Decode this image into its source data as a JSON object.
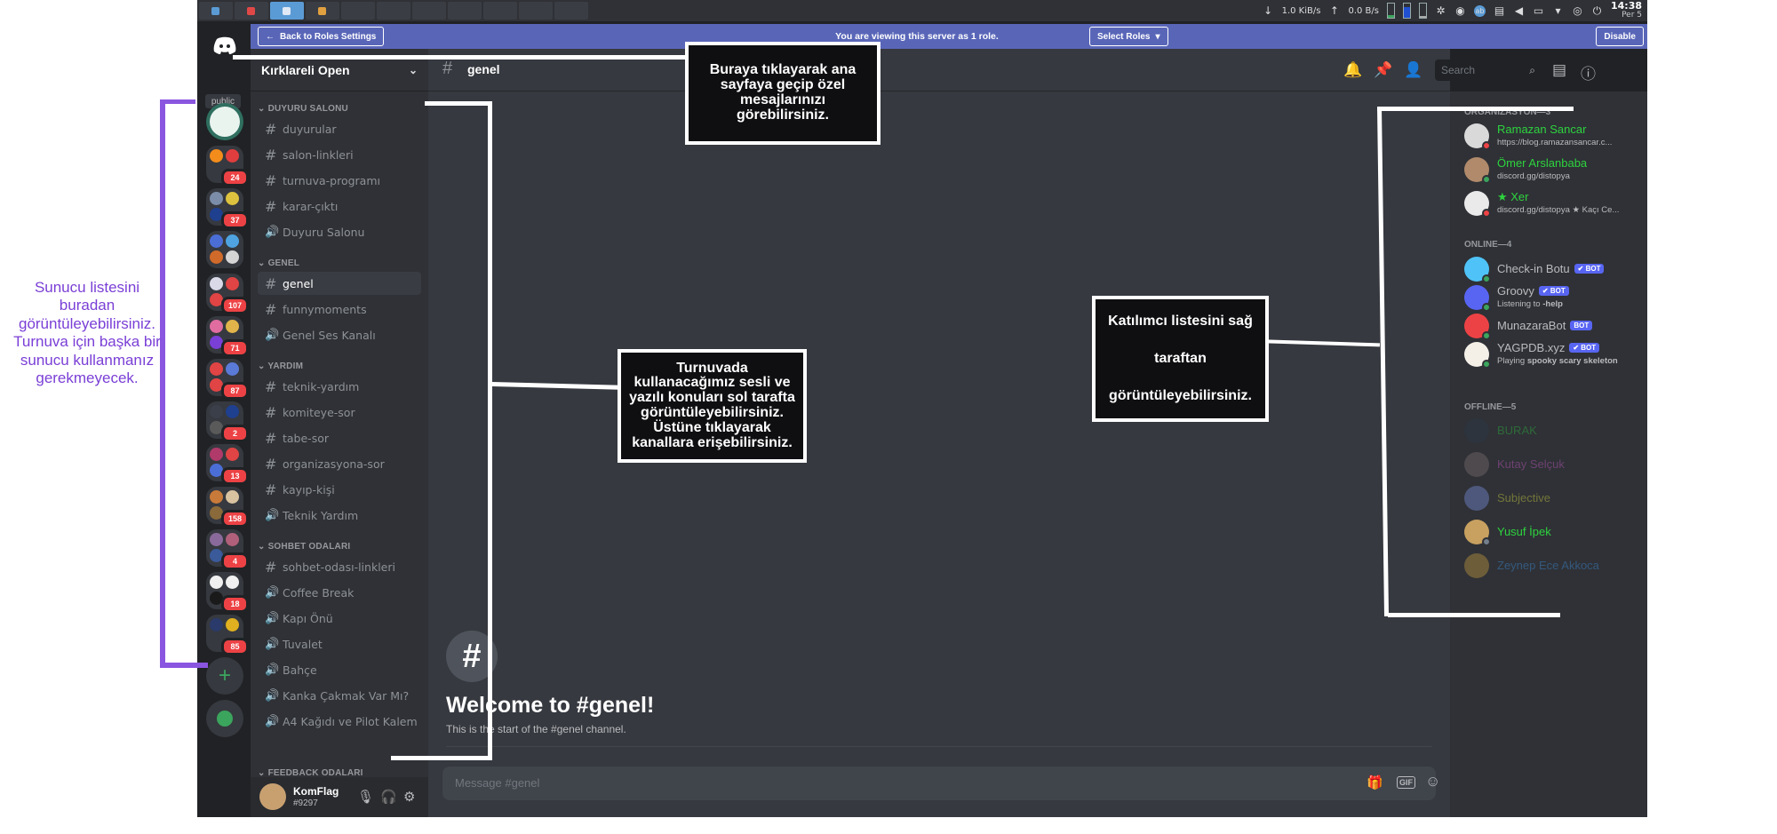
{
  "taskbar": {
    "net_down": "1.0 KiB/s",
    "net_up": "0.0 B/s",
    "clock_time": "14:38",
    "clock_day": "Per 5"
  },
  "notice": {
    "back_label": "Back to Roles Settings",
    "text": "You are viewing this server as 1 role.",
    "select_roles_label": "Select Roles",
    "disable_label": "Disable"
  },
  "rail": {
    "public_label": "public",
    "badges": [
      "24",
      "37",
      "107",
      "71",
      "87",
      "2",
      "13",
      "158",
      "4",
      "18",
      "85"
    ]
  },
  "guild": {
    "name": "Kırklareli Open"
  },
  "categories": {
    "c1": "DUYURU SALONU",
    "c2": "GENEL",
    "c3": "YARDIM",
    "c4": "SOHBET ODALARI",
    "c5": "FEEDBACK ODALARI"
  },
  "channels": [
    "duyurular",
    "salon-linkleri",
    "turnuva-programı",
    "karar-çıktı",
    "Duyuru Salonu",
    "genel",
    "funnymoments",
    "Genel Ses Kanalı",
    "teknik-yardım",
    "komiteye-sor",
    "tabe-sor",
    "organizasyona-sor",
    "kayıp-kişi",
    "Teknik Yardım",
    "sohbet-odası-linkleri",
    "Coffee Break",
    "Kapı Önü",
    "Tuvalet",
    "Bahçe",
    "Kanka Çakmak Var Mı?",
    "A4 Kağıdı ve Pilot Kalem"
  ],
  "user": {
    "name": "KomFlag",
    "tag": "#9297"
  },
  "main": {
    "channel_name": "genel",
    "search_placeholder": "Search",
    "welcome_title": "Welcome to #genel!",
    "welcome_sub": "This is the start of the #genel channel.",
    "composer_placeholder": "Message #genel",
    "gif_label": "GIF"
  },
  "members": {
    "cat_org": "ORGANIZASYON—3",
    "cat_online": "ONLINE—4",
    "cat_offline": "OFFLINE—5",
    "bot_label": "BOT",
    "org": [
      {
        "name": "Ramazan Sancar",
        "sub": "https://blog.ramazansancar.c..."
      },
      {
        "name": "Ömer Arslanbaba",
        "sub": "discord.gg/distopya"
      },
      {
        "name": "★ Xer",
        "sub": "discord.gg/distopya ★ Kaçı Ce..."
      }
    ],
    "online": [
      {
        "name": "Check-in Botu",
        "sub": ""
      },
      {
        "name": "Groovy",
        "sub_prefix": "Listening to ",
        "sub_bold": "-help"
      },
      {
        "name": "MunazaraBot",
        "sub": ""
      },
      {
        "name": "YAGPDB.xyz",
        "sub_prefix": "Playing ",
        "sub_bold": "spooky scary skeleton"
      }
    ],
    "offline": [
      "BURAK",
      "Kutay Selçuk",
      "Subjective",
      "Yusuf İpek",
      "Zeynep Ece Akkoca"
    ]
  },
  "annotations": {
    "top": "Buraya tıklayarak ana sayfaya geçip özel mesajlarınızı görebilirsiniz.",
    "channels": "Turnuvada kullanacağımız sesli ve yazılı konuları sol tarafta görüntüleyebilirsiniz. Üstüne tıklayarak kanallara erişebilirsiniz.",
    "members_1": "Katılımcı listesini sağ",
    "members_2": "taraftan",
    "members_3": "görüntüleyebilirsiniz.",
    "left": "Sunucu listesini buradan görüntüleyebilirsiniz. Turnuva için başka bir sunucu kullanmanız gerekmeyecek."
  },
  "colors": {
    "blurple": "#5865f2",
    "online_green": "#3ba55d",
    "dnd_red": "#ed4245",
    "annotation_purple": "#7a3fd6"
  }
}
